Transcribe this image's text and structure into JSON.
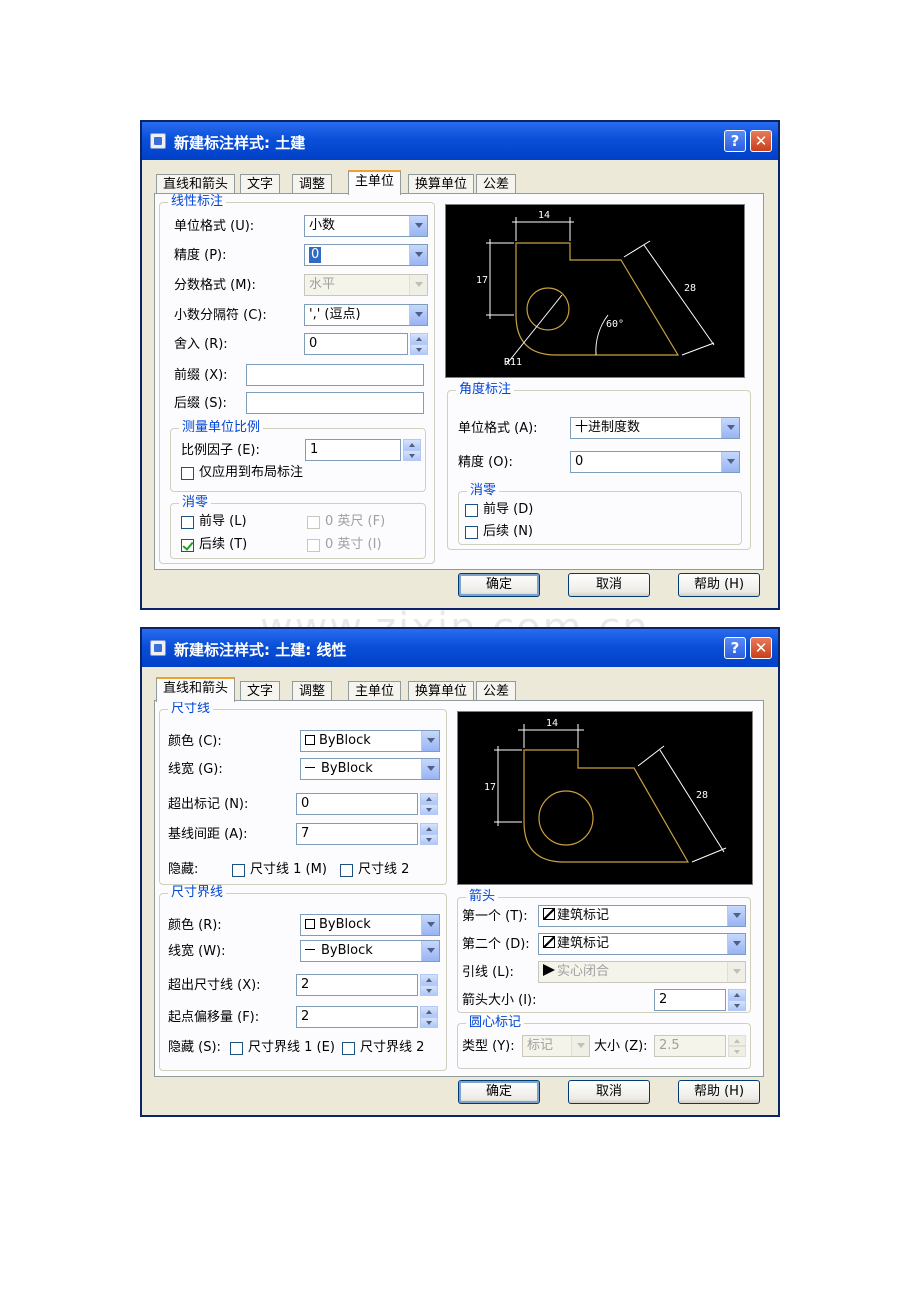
{
  "watermark": "www.zixin.com.cn",
  "dialog1": {
    "title": "新建标注样式: 土建",
    "help_glyph": "?",
    "close_glyph": "✕",
    "tabs": [
      "直线和箭头",
      "文字",
      "调整",
      "主单位",
      "换算单位",
      "公差"
    ],
    "active_tab": "主单位",
    "linear": {
      "legend": "线性标注",
      "unit_format_label": "单位格式 (U):",
      "unit_format_value": "小数",
      "precision_label": "精度 (P):",
      "precision_value": "0",
      "fraction_format_label": "分数格式 (M):",
      "fraction_format_value": "水平",
      "decimal_sep_label": "小数分隔符 (C):",
      "decimal_sep_value": "','  (逗点)",
      "round_label": "舍入 (R):",
      "round_value": "0",
      "prefix_label": "前缀 (X):",
      "prefix_value": "",
      "suffix_label": "后缀 (S):",
      "suffix_value": ""
    },
    "scale": {
      "legend": "测量单位比例",
      "factor_label": "比例因子 (E):",
      "factor_value": "1",
      "layout_only_label": "仅应用到布局标注"
    },
    "zero_suppression": {
      "legend": "消零",
      "leading_label": "前导 (L)",
      "trailing_label": "后续 (T)",
      "feet_label": "0 英尺 (F)",
      "inches_label": "0 英寸 (I)"
    },
    "angular": {
      "legend": "角度标注",
      "unit_format_label": "单位格式 (A):",
      "unit_format_value": "十进制度数",
      "precision_label": "精度 (O):",
      "precision_value": "0",
      "zero_legend": "消零",
      "leading_label": "前导 (D)",
      "trailing_label": "后续 (N)"
    },
    "preview": {
      "dim_top": "14",
      "dim_left": "17",
      "dim_right": "28",
      "dim_angle": "60°",
      "dim_radius": "R11"
    },
    "buttons": {
      "ok": "确定",
      "cancel": "取消",
      "help": "帮助 (H)"
    }
  },
  "dialog2": {
    "title": "新建标注样式: 土建: 线性",
    "help_glyph": "?",
    "close_glyph": "✕",
    "tabs": [
      "直线和箭头",
      "文字",
      "调整",
      "主单位",
      "换算单位",
      "公差"
    ],
    "active_tab": "直线和箭头",
    "dim_lines": {
      "legend": "尺寸线",
      "color_label": "颜色 (C):",
      "color_value": "ByBlock",
      "lineweight_label": "线宽 (G):",
      "lineweight_value": "ByBlock",
      "extend_ticks_label": "超出标记 (N):",
      "extend_ticks_value": "0",
      "baseline_spacing_label": "基线间距 (A):",
      "baseline_spacing_value": "7",
      "suppress_label": "隐藏:",
      "suppress_1_label": "尺寸线 1 (M)",
      "suppress_2_label": "尺寸线 2"
    },
    "ext_lines": {
      "legend": "尺寸界线",
      "color_label": "颜色 (R):",
      "color_value": "ByBlock",
      "lineweight_label": "线宽 (W):",
      "lineweight_value": "ByBlock",
      "extend_beyond_label": "超出尺寸线 (X):",
      "extend_beyond_value": "2",
      "offset_label": "起点偏移量 (F):",
      "offset_value": "2",
      "suppress_label": "隐藏 (S):",
      "suppress_1_label": "尺寸界线 1 (E)",
      "suppress_2_label": "尺寸界线 2"
    },
    "arrows": {
      "legend": "箭头",
      "first_label": "第一个 (T):",
      "first_value": "建筑标记",
      "second_label": "第二个 (D):",
      "second_value": "建筑标记",
      "leader_label": "引线 (L):",
      "leader_value": "实心闭合",
      "size_label": "箭头大小 (I):",
      "size_value": "2"
    },
    "center_marks": {
      "legend": "圆心标记",
      "type_label": "类型 (Y):",
      "type_value": "标记",
      "size_label": "大小 (Z):",
      "size_value": "2.5"
    },
    "preview": {
      "dim_top": "14",
      "dim_left": "17",
      "dim_right": "28"
    },
    "buttons": {
      "ok": "确定",
      "cancel": "取消",
      "help": "帮助 (H)"
    }
  },
  "colors": {
    "titlebar": "#0a4fd8",
    "dialog_bg": "#ece9d8",
    "legend_text": "#0046d5",
    "preview_geometry": "#c8a040",
    "preview_dims": "#ffffff"
  }
}
